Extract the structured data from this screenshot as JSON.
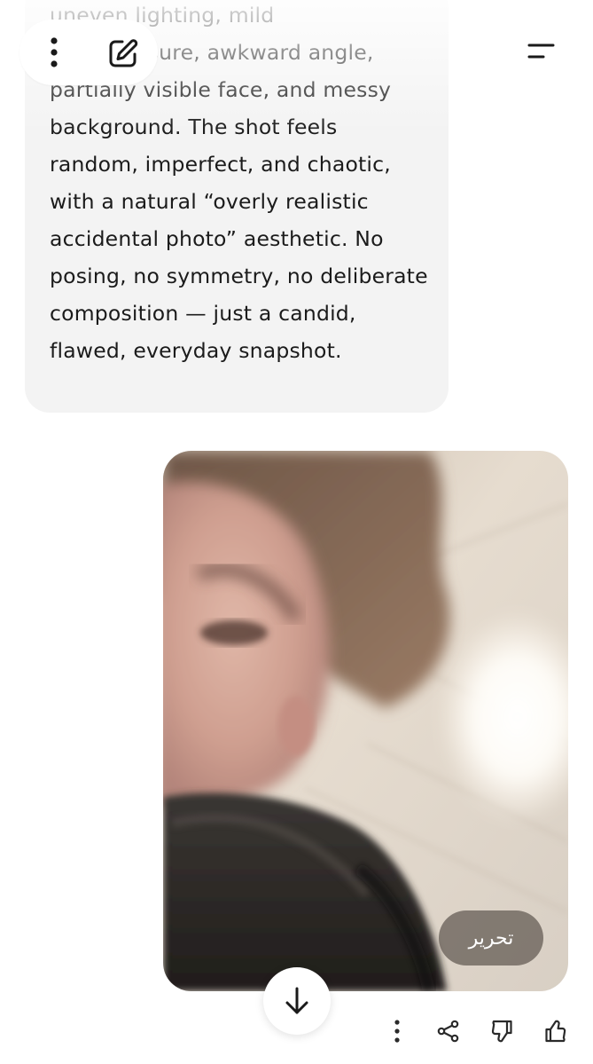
{
  "user_message": {
    "text": "uneven lighting, mild overexposure, awkward angle, partially visible face, and messy background. The shot feels random, imperfect, and chaotic, with a natural “overly realistic accidental photo” aesthetic. No posing, no symmetry, no deliberate composition — just a candid, flawed, everyday snapshot."
  },
  "top_bar": {
    "icons": {
      "more": "more-vertical-icon",
      "edit": "edit-icon",
      "menu": "menu-icon"
    }
  },
  "generated_image": {
    "edit_label": "تحرير"
  },
  "scroll_button": {
    "icon": "arrow-down-icon"
  },
  "actions": {
    "icons": [
      "more-vertical-icon",
      "share-icon",
      "thumbs-down-icon",
      "thumbs-up-icon"
    ]
  },
  "colors": {
    "bubble_bg": "#f3f3f3",
    "text": "#1b1b1b",
    "chip_bg": "#5f5850"
  }
}
